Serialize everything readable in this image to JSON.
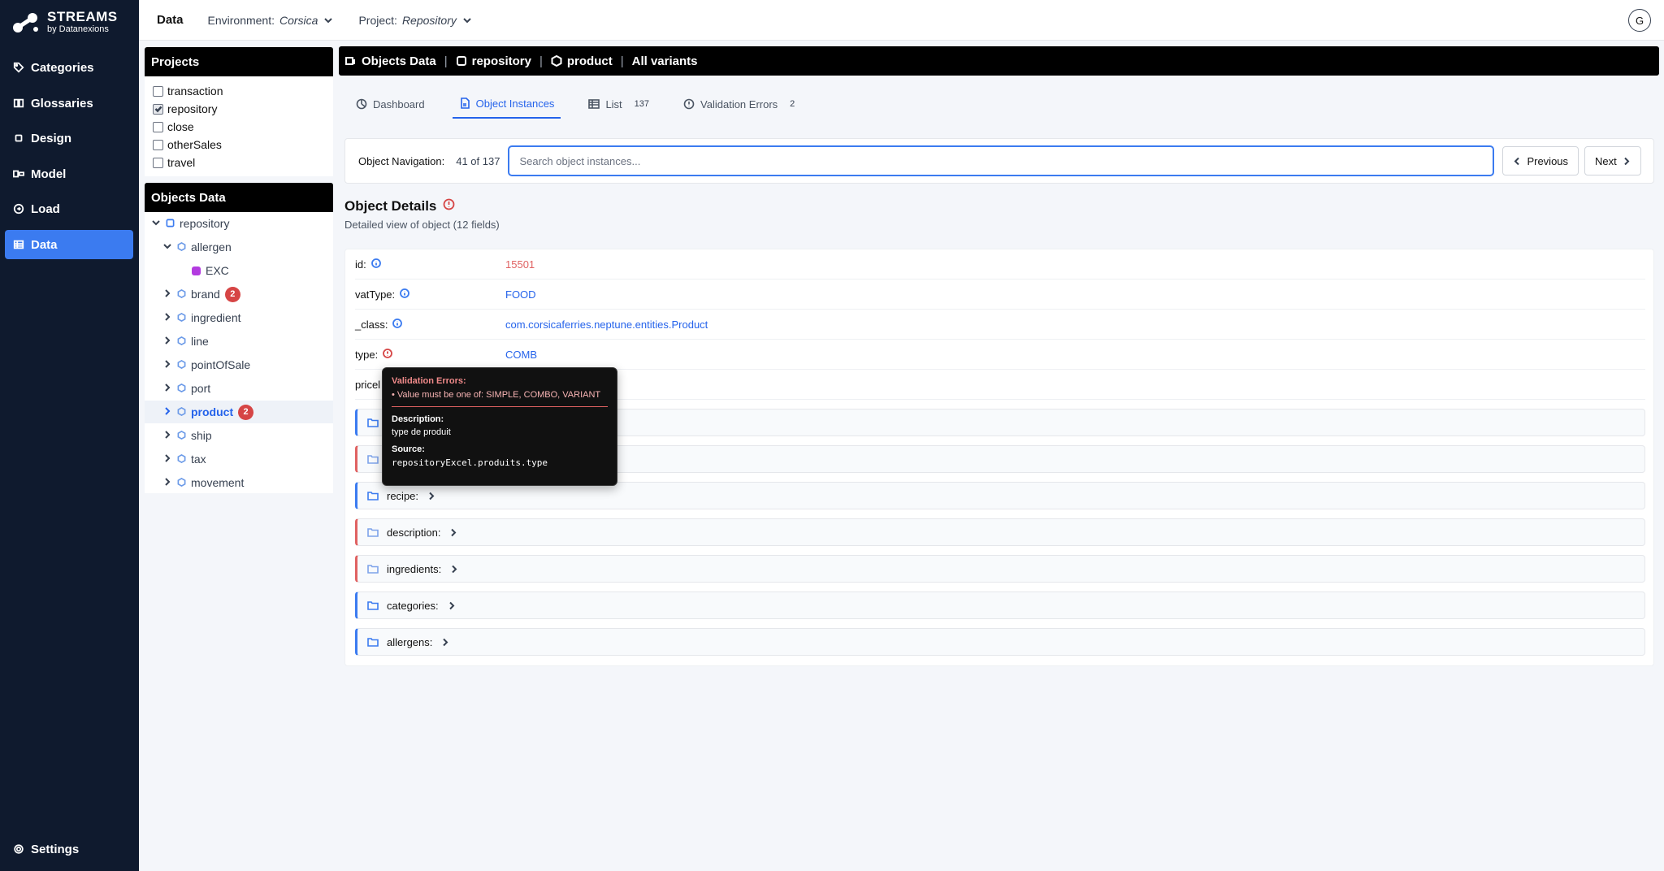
{
  "brand": {
    "name": "STREAMS",
    "sub": "by Datanexions"
  },
  "sidenav": {
    "items": [
      {
        "label": "Categories",
        "icon": "tag-icon"
      },
      {
        "label": "Glossaries",
        "icon": "book-icon"
      },
      {
        "label": "Design",
        "icon": "square-icon"
      },
      {
        "label": "Model",
        "icon": "model-icon"
      },
      {
        "label": "Load",
        "icon": "load-icon"
      },
      {
        "label": "Data",
        "icon": "table-icon",
        "active": true
      }
    ],
    "settings": "Settings"
  },
  "topbar": {
    "section": "Data",
    "env_label": "Environment:",
    "env_value": "Corsica",
    "proj_label": "Project:",
    "proj_value": "Repository",
    "avatar": "G"
  },
  "projects": {
    "title": "Projects",
    "items": [
      {
        "label": "transaction",
        "checked": false
      },
      {
        "label": "repository",
        "checked": true
      },
      {
        "label": "close",
        "checked": false
      },
      {
        "label": "otherSales",
        "checked": false
      },
      {
        "label": "travel",
        "checked": false
      }
    ]
  },
  "objects_data": {
    "title": "Objects Data",
    "root": "repository",
    "nodes": [
      {
        "label": "allergen",
        "expanded": true
      },
      {
        "label": "EXC",
        "child": true
      },
      {
        "label": "brand",
        "badge": "2"
      },
      {
        "label": "ingredient"
      },
      {
        "label": "line"
      },
      {
        "label": "pointOfSale"
      },
      {
        "label": "port"
      },
      {
        "label": "product",
        "badge": "2",
        "selected": true
      },
      {
        "label": "ship"
      },
      {
        "label": "tax"
      },
      {
        "label": "movement"
      }
    ]
  },
  "main_header": {
    "objects_data": "Objects Data",
    "repository": "repository",
    "product": "product",
    "variants": "All variants"
  },
  "tabs": [
    {
      "label": "Dashboard"
    },
    {
      "label": "Object Instances",
      "active": true
    },
    {
      "label": "List",
      "count": "137"
    },
    {
      "label": "Validation Errors",
      "count": "2"
    }
  ],
  "navigation": {
    "label": "Object Navigation:",
    "position": "41 of 137",
    "placeholder": "Search object instances...",
    "prev": "Previous",
    "next": "Next"
  },
  "details": {
    "title": "Object Details",
    "subtitle": "Detailed view of object (12 fields)",
    "fields": [
      {
        "name": "id:",
        "value": "15501",
        "error": true
      },
      {
        "name": "vatType:",
        "value": "FOOD"
      },
      {
        "name": "_class:",
        "value": "com.corsicaferries.neptune.entities.Product"
      },
      {
        "name": "type:",
        "value": "COMB",
        "invalid": true
      },
      {
        "name": "pricel",
        "value": ""
      }
    ],
    "groups": [
      {
        "label": "",
        "red": false
      },
      {
        "label": "",
        "red": true
      },
      {
        "label": "recipe:",
        "red": false
      },
      {
        "label": "description:",
        "red": true
      },
      {
        "label": "ingredients:",
        "red": true
      },
      {
        "label": "categories:",
        "red": false
      },
      {
        "label": "allergens:",
        "red": false
      }
    ]
  },
  "tooltip": {
    "err_title": "Validation Errors:",
    "err_msg": "• Value must be one of: SIMPLE, COMBO, VARIANT",
    "desc_h": "Description:",
    "desc_v": "type de produit",
    "src_h": "Source:",
    "src_v": "repositoryExcel.produits.type"
  },
  "colors": {
    "accent": "#3b7bf0",
    "nav_bg": "#0f1a2e",
    "error": "#d64545"
  }
}
